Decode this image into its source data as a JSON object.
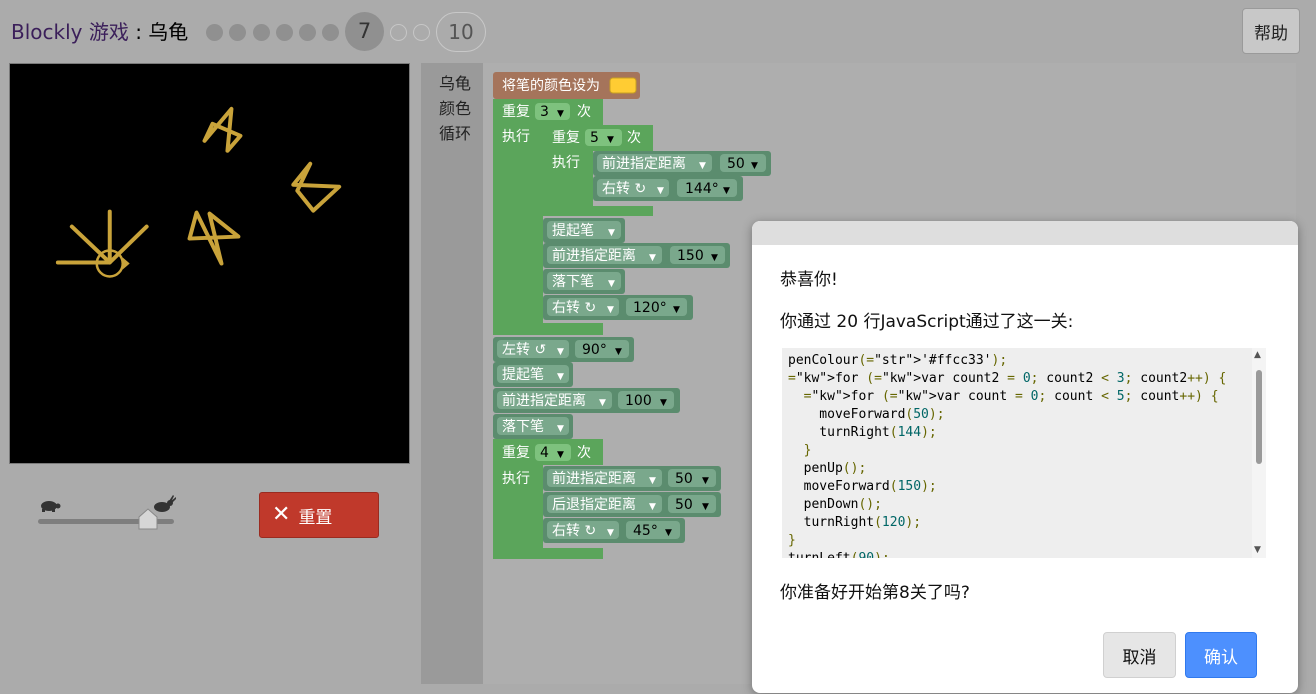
{
  "header": {
    "brand": "Blockly 游戏",
    "separator": " : ",
    "game_name": "乌龟",
    "current_level": "7",
    "last_level": "10",
    "help_label": "帮助"
  },
  "controls": {
    "reset_label": "重置",
    "slow_icon": "turtle-icon",
    "fast_icon": "rabbit-icon",
    "speed_value": 0.8
  },
  "toolbox": {
    "categories": [
      "乌龟",
      "颜色",
      "循环"
    ]
  },
  "workspace": {
    "set_colour": "将笔的颜色设为",
    "pen_colour": "#ffcc33",
    "repeat": "重复",
    "times": "次",
    "do": "执行",
    "outer_repeat_count": "3",
    "inner_repeat_count": "5",
    "move_forward": "前进指定距离",
    "move_backward": "后退指定距离",
    "turn_right": "右转 ↻",
    "turn_left": "左转 ↺",
    "pen_up": "提起笔",
    "pen_down": "落下笔",
    "v50": "50",
    "v144": "144°",
    "v150": "150",
    "v120": "120°",
    "v90": "90°",
    "v100": "100",
    "last_repeat_count": "4",
    "v45": "45°"
  },
  "dialog": {
    "congrats": "恭喜你!",
    "message": "你通过 20 行JavaScript通过了这一关:",
    "code": [
      "penColour('#ffcc33');",
      "for (var count2 = 0; count2 < 3; count2++) {",
      "  for (var count = 0; count < 5; count++) {",
      "    moveForward(50);",
      "    turnRight(144);",
      "  }",
      "  penUp();",
      "  moveForward(150);",
      "  penDown();",
      "  turnRight(120);",
      "}",
      "turnLeft(90);"
    ],
    "next_question": "你准备好开始第8关了吗?",
    "cancel_label": "取消",
    "ok_label": "确认"
  },
  "colors": {
    "turtle_block": "#5b8c6e",
    "loop_block": "#5ba55b",
    "colour_block": "#a5745b",
    "pen": "#c9a33a",
    "reset": "#c0392b",
    "ok": "#4d90fe"
  }
}
